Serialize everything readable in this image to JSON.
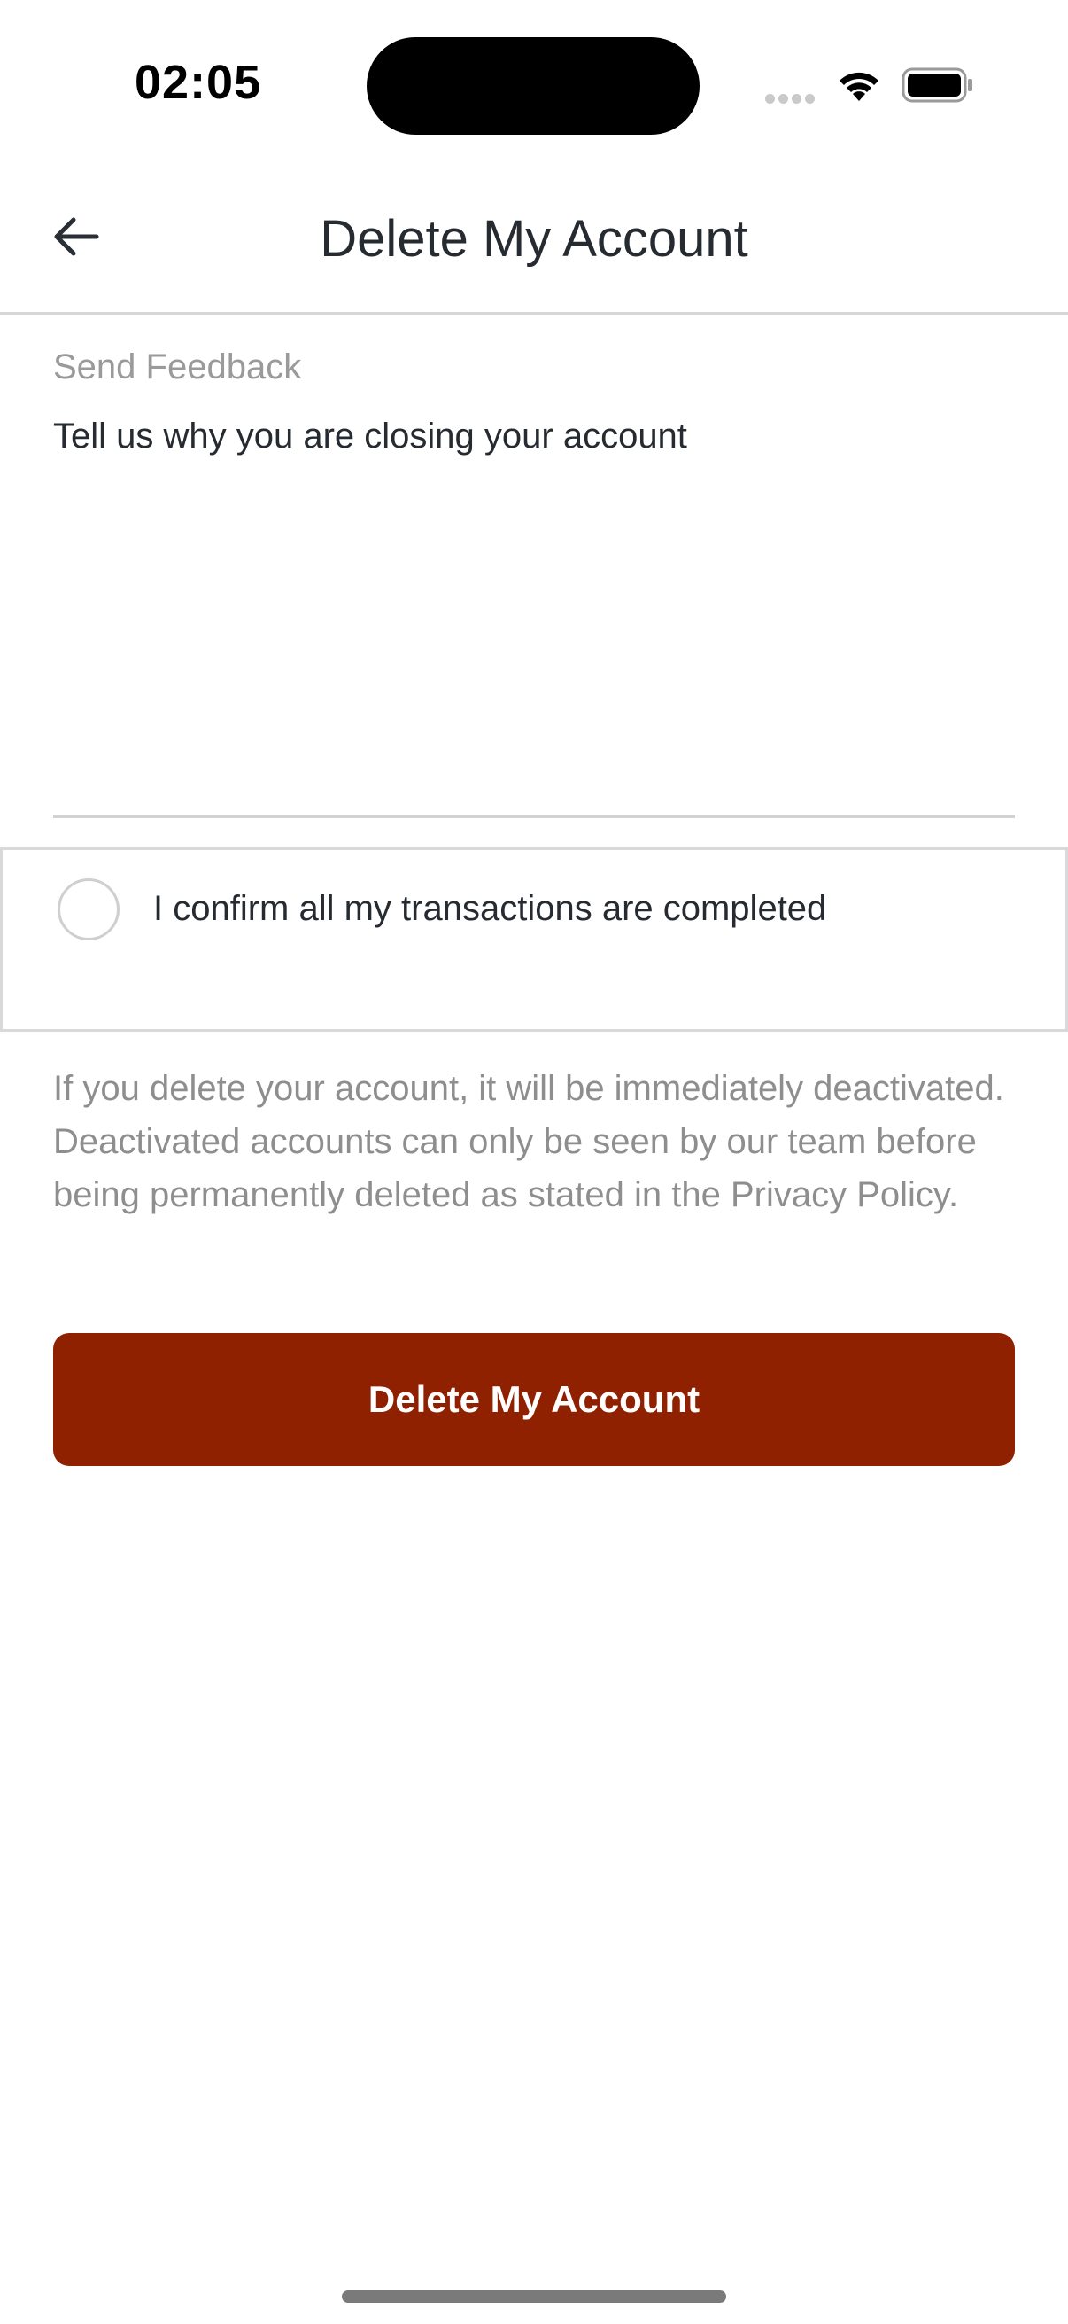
{
  "status_bar": {
    "time": "02:05",
    "icons": [
      "signal-icon",
      "wifi-icon",
      "battery-icon"
    ]
  },
  "header": {
    "back_icon": "arrow-left-icon",
    "title": "Delete My Account"
  },
  "feedback": {
    "label": "Send Feedback",
    "placeholder": "Tell us why you are closing your account",
    "value": ""
  },
  "confirm": {
    "label": "I confirm all my transactions are completed",
    "checked": false
  },
  "disclaimer": "If you delete your account, it will be immediately deactivated. Deactivated accounts can only be seen by our team before being permanently deleted as stated in the Privacy Policy.",
  "actions": {
    "delete_label": "Delete My Account"
  },
  "colors": {
    "accent": "#8f2100",
    "muted_text": "#8e8e8e",
    "divider": "#d7d7d9"
  }
}
